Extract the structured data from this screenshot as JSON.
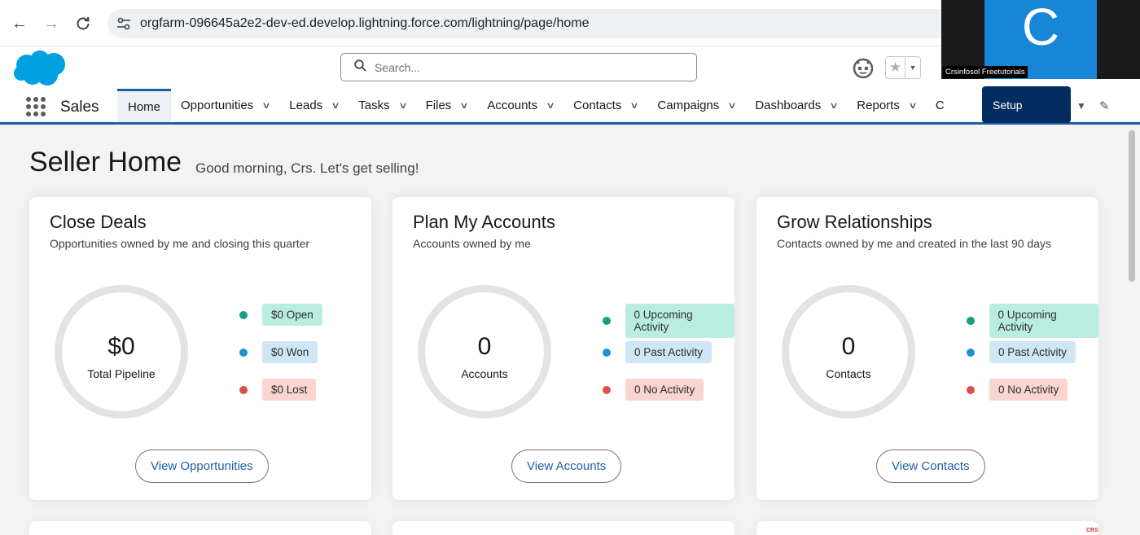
{
  "browser": {
    "url": "orgfarm-096645a2e2-dev-ed.develop.lightning.force.com/lightning/page/home"
  },
  "header": {
    "search_placeholder": "Search..."
  },
  "nav": {
    "app_name": "Sales",
    "items": [
      {
        "label": "Home",
        "active": true,
        "dropdown": false
      },
      {
        "label": "Opportunities",
        "dropdown": true
      },
      {
        "label": "Leads",
        "dropdown": true
      },
      {
        "label": "Tasks",
        "dropdown": true
      },
      {
        "label": "Files",
        "dropdown": true
      },
      {
        "label": "Accounts",
        "dropdown": true
      },
      {
        "label": "Contacts",
        "dropdown": true
      },
      {
        "label": "Campaigns",
        "dropdown": true
      },
      {
        "label": "Dashboards",
        "dropdown": true
      },
      {
        "label": "Reports",
        "dropdown": true
      },
      {
        "label": "C",
        "dropdown": false
      }
    ],
    "setup_tooltip": "Setup"
  },
  "video_overlay": {
    "initial": "C",
    "participant_name": "Crsinfosol Freetutorials"
  },
  "page": {
    "title": "Seller Home",
    "greeting": "Good morning, Crs. Let's get selling!"
  },
  "cards": [
    {
      "title": "Close Deals",
      "subtitle": "Opportunities owned by me and closing this quarter",
      "ring_value": "$0",
      "ring_label": "Total Pipeline",
      "legend": [
        {
          "label": "$0 Open",
          "dot": "#1a9c86",
          "bg": "#b9ede0"
        },
        {
          "label": "$0 Won",
          "dot": "#1e8fd1",
          "bg": "#cfe7f5"
        },
        {
          "label": "$0 Lost",
          "dot": "#d9514a",
          "bg": "#f8d5d1"
        }
      ],
      "button": "View Opportunities"
    },
    {
      "title": "Plan My Accounts",
      "subtitle": "Accounts owned by me",
      "ring_value": "0",
      "ring_label": "Accounts",
      "legend": [
        {
          "label": "0 Upcoming Activity",
          "dot": "#1a9c86",
          "bg": "#b9ede0"
        },
        {
          "label": "0 Past Activity",
          "dot": "#1e8fd1",
          "bg": "#cfe7f5"
        },
        {
          "label": "0 No Activity",
          "dot": "#d9514a",
          "bg": "#f8d5d1"
        }
      ],
      "button": "View Accounts"
    },
    {
      "title": "Grow Relationships",
      "subtitle": "Contacts owned by me and created in the last 90 days",
      "ring_value": "0",
      "ring_label": "Contacts",
      "legend": [
        {
          "label": "0 Upcoming Activity",
          "dot": "#1a9c86",
          "bg": "#b9ede0"
        },
        {
          "label": "0 Past Activity",
          "dot": "#1e8fd1",
          "bg": "#cfe7f5"
        },
        {
          "label": "0 No Activity",
          "dot": "#d9514a",
          "bg": "#f8d5d1"
        }
      ],
      "button": "View Contacts"
    }
  ],
  "watermark": "CRS",
  "colors": {
    "brand_blue": "#1b5fa8",
    "salesforce_cloud": "#00a1e0",
    "setup_tooltip": "#032d60"
  }
}
